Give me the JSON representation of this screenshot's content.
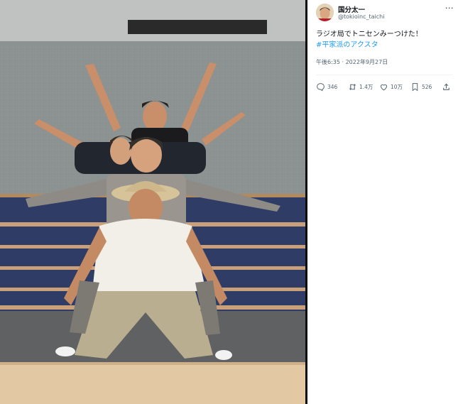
{
  "tweet": {
    "author_name": "国分太一",
    "author_handle": "@tokioinc_taichi",
    "text_line1": "ラジオ局でトニセンみーつけた！",
    "hashtag": "#平家派のアクスタ",
    "timestamp": "午後6:35 · 2022年9月27日",
    "more_icon": "···"
  },
  "actions": {
    "reply": {
      "icon": "reply-icon",
      "count": "346"
    },
    "retweet": {
      "icon": "retweet-icon",
      "count": "1.4万"
    },
    "like": {
      "icon": "heart-icon",
      "count": "10万"
    },
    "bookmark": {
      "icon": "bookmark-icon",
      "count": "526"
    },
    "share": {
      "icon": "share-icon"
    }
  },
  "colors": {
    "accent": "#1d9bf0",
    "text": "#0f1419",
    "muted": "#536471"
  }
}
